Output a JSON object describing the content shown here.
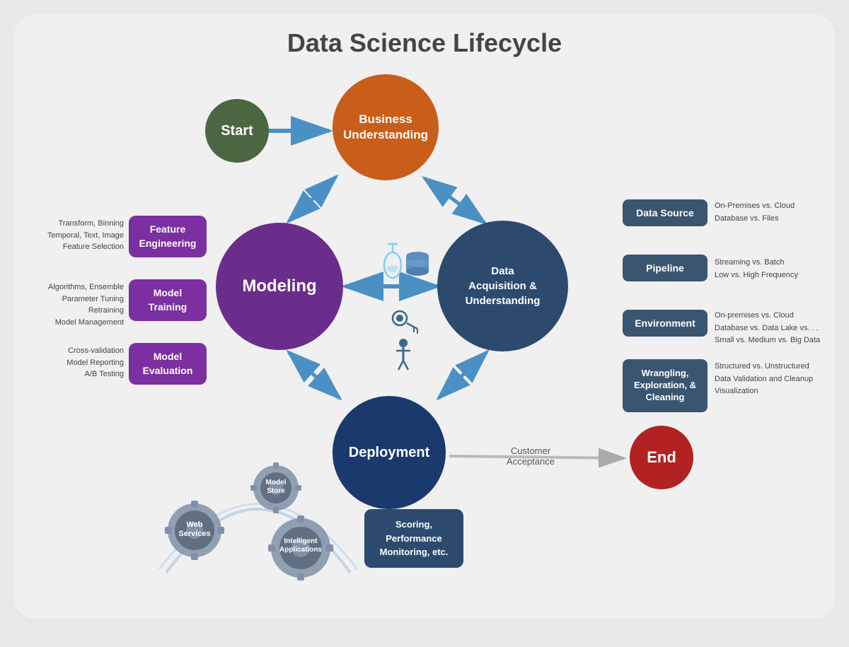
{
  "title": "Data Science Lifecycle",
  "circles": {
    "start": "Start",
    "business": "Business\nUnderstanding",
    "modeling": "Modeling",
    "data_acq": "Data\nAcquisition &\nUnderstanding",
    "deployment": "Deployment",
    "end": "End"
  },
  "left_boxes": {
    "feature_eng": "Feature\nEngineering",
    "model_train": "Model\nTraining",
    "model_eval": "Model\nEvaluation"
  },
  "left_labels": {
    "feature": "Transform, Binning\nTemporal, Text, Image\nFeature Selection",
    "model_train": "Algorithms, Ensemble\nParameter Tuning\nRetraining\nModel Management",
    "model_eval": "Cross-validation\nModel Reporting\nA/B Testing"
  },
  "right_boxes": {
    "data_source": "Data Source",
    "pipeline": "Pipeline",
    "environment": "Environment",
    "wrangling": "Wrangling,\nExploration, &\nCleaning"
  },
  "right_labels": {
    "data_source": "On-Premises vs. Cloud\nDatabase vs. Files",
    "pipeline": "Streaming vs. Batch\nLow vs. High Frequency",
    "environment": "On-premises vs. Cloud\nDatabase vs. Data Lake vs. . .\nSmall vs. Medium vs. Big Data",
    "wrangling": "Structured vs. Unstructured\nData Validation and Cleanup\nVisualization"
  },
  "bottom": {
    "scoring": "Scoring,\nPerformance\nMonitoring, etc.",
    "customer_acceptance": "Customer\nAcceptance",
    "gears": {
      "model_store": "Model\nStore",
      "web_services": "Web\nServices",
      "intelligent_apps": "Intelligent\nApplications"
    }
  }
}
